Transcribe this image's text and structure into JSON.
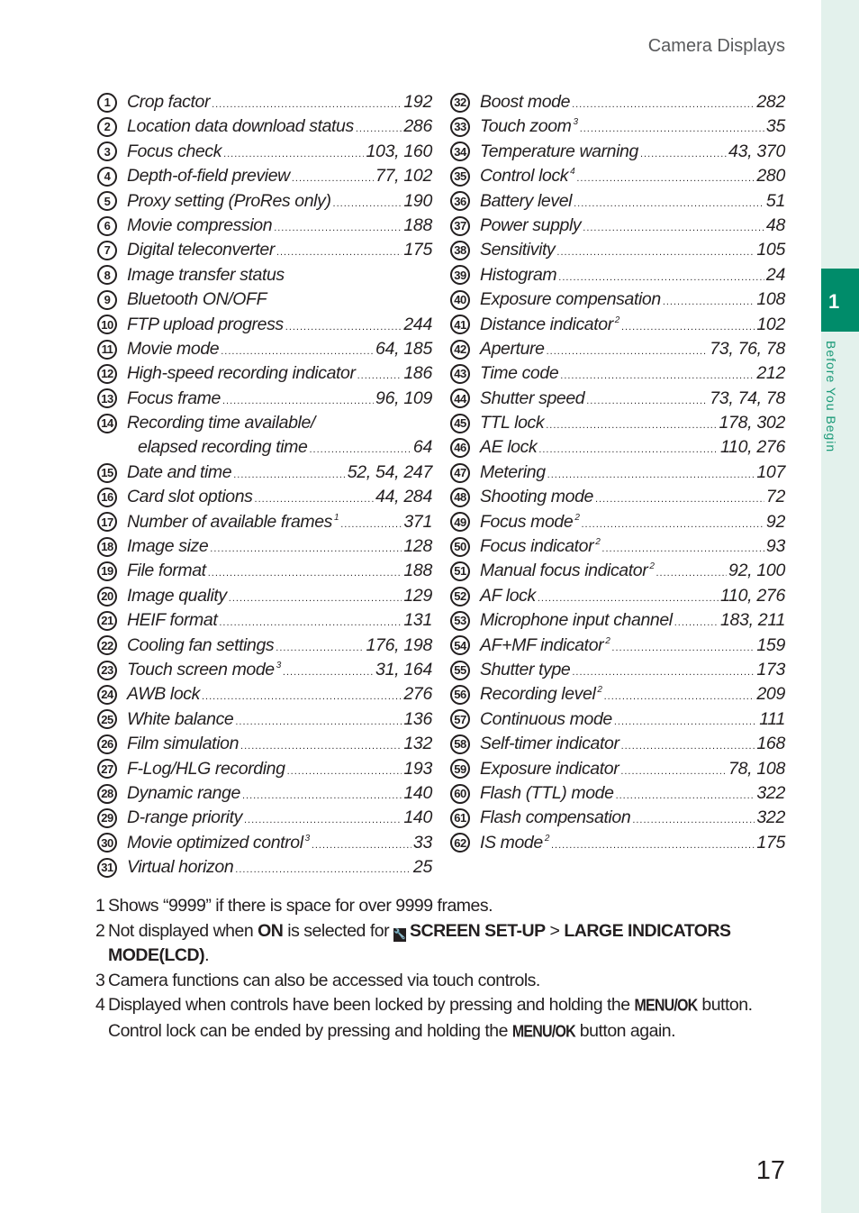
{
  "header": {
    "running_head": "Camera Displays"
  },
  "side_tab": {
    "chapter_number": "1",
    "chapter_title": "Before You Begin",
    "accent_color": "#008c6a",
    "strip_color": "#e3f1ec"
  },
  "page_number": "17",
  "left_column": [
    {
      "num": "1",
      "text": "Crop factor",
      "sup": "",
      "pages": "192"
    },
    {
      "num": "2",
      "text": "Location data download status",
      "sup": "",
      "pages": "286"
    },
    {
      "num": "3",
      "text": "Focus check",
      "sup": "",
      "pages": "103, 160"
    },
    {
      "num": "4",
      "text": "Depth-of-field preview",
      "sup": "",
      "pages": "77, 102"
    },
    {
      "num": "5",
      "text": "Proxy setting (ProRes only)",
      "sup": "",
      "pages": "190"
    },
    {
      "num": "6",
      "text": "Movie compression",
      "sup": "",
      "pages": "188"
    },
    {
      "num": "7",
      "text": "Digital teleconverter",
      "sup": "",
      "pages": "175"
    },
    {
      "num": "8",
      "text": "Image transfer status",
      "sup": "",
      "pages": ""
    },
    {
      "num": "9",
      "text": "Bluetooth ON/OFF",
      "sup": "",
      "pages": ""
    },
    {
      "num": "10",
      "text": "FTP upload progress",
      "sup": "",
      "pages": "244"
    },
    {
      "num": "11",
      "text": "Movie mode",
      "sup": "",
      "pages": "64, 185"
    },
    {
      "num": "12",
      "text": "High-speed recording indicator",
      "sup": "",
      "pages": "186"
    },
    {
      "num": "13",
      "text": "Focus frame",
      "sup": "",
      "pages": "96, 109"
    },
    {
      "num": "14",
      "text": "Recording time available/",
      "sup": "",
      "pages": ""
    },
    {
      "num": "",
      "text": "elapsed recording time",
      "sup": "",
      "pages": "64",
      "continuation": true
    },
    {
      "num": "15",
      "text": "Date and time",
      "sup": "",
      "pages": "52, 54, 247"
    },
    {
      "num": "16",
      "text": "Card slot options",
      "sup": "",
      "pages": "44, 284"
    },
    {
      "num": "17",
      "text": "Number of available frames",
      "sup": "1",
      "pages": "371"
    },
    {
      "num": "18",
      "text": "Image size",
      "sup": "",
      "pages": "128"
    },
    {
      "num": "19",
      "text": "File format",
      "sup": "",
      "pages": "188"
    },
    {
      "num": "20",
      "text": "Image quality",
      "sup": "",
      "pages": "129"
    },
    {
      "num": "21",
      "text": "HEIF format",
      "sup": "",
      "pages": "131"
    },
    {
      "num": "22",
      "text": "Cooling fan settings",
      "sup": "",
      "pages": "176, 198"
    },
    {
      "num": "23",
      "text": "Touch screen mode",
      "sup": "3",
      "pages": "31, 164"
    },
    {
      "num": "24",
      "text": "AWB lock",
      "sup": "",
      "pages": "276"
    },
    {
      "num": "25",
      "text": "White balance",
      "sup": "",
      "pages": "136"
    },
    {
      "num": "26",
      "text": "Film simulation",
      "sup": "",
      "pages": "132"
    },
    {
      "num": "27",
      "text": "F-Log/HLG recording",
      "sup": "",
      "pages": "193"
    },
    {
      "num": "28",
      "text": "Dynamic range",
      "sup": "",
      "pages": "140"
    },
    {
      "num": "29",
      "text": "D-range priority",
      "sup": "",
      "pages": "140"
    },
    {
      "num": "30",
      "text": "Movie optimized control",
      "sup": "3",
      "pages": "33"
    },
    {
      "num": "31",
      "text": "Virtual horizon",
      "sup": "",
      "pages": "25"
    }
  ],
  "right_column": [
    {
      "num": "32",
      "text": "Boost mode",
      "sup": "",
      "pages": "282"
    },
    {
      "num": "33",
      "text": "Touch zoom",
      "sup": "3",
      "pages": "35"
    },
    {
      "num": "34",
      "text": "Temperature warning",
      "sup": "",
      "pages": "43, 370"
    },
    {
      "num": "35",
      "text": "Control lock",
      "sup": "4",
      "pages": "280"
    },
    {
      "num": "36",
      "text": "Battery level",
      "sup": "",
      "pages": "51"
    },
    {
      "num": "37",
      "text": "Power supply",
      "sup": "",
      "pages": "48"
    },
    {
      "num": "38",
      "text": "Sensitivity",
      "sup": "",
      "pages": "105"
    },
    {
      "num": "39",
      "text": "Histogram",
      "sup": "",
      "pages": "24"
    },
    {
      "num": "40",
      "text": "Exposure compensation",
      "sup": "",
      "pages": "108"
    },
    {
      "num": "41",
      "text": "Distance indicator",
      "sup": "2",
      "pages": "102"
    },
    {
      "num": "42",
      "text": "Aperture",
      "sup": "",
      "pages": "73, 76, 78"
    },
    {
      "num": "43",
      "text": "Time code",
      "sup": "",
      "pages": "212"
    },
    {
      "num": "44",
      "text": "Shutter speed",
      "sup": "",
      "pages": "73, 74, 78"
    },
    {
      "num": "45",
      "text": "TTL lock",
      "sup": "",
      "pages": "178, 302"
    },
    {
      "num": "46",
      "text": "AE lock",
      "sup": "",
      "pages": "110, 276"
    },
    {
      "num": "47",
      "text": "Metering",
      "sup": "",
      "pages": "107"
    },
    {
      "num": "48",
      "text": "Shooting mode",
      "sup": "",
      "pages": "72"
    },
    {
      "num": "49",
      "text": "Focus mode",
      "sup": "2",
      "pages": "92"
    },
    {
      "num": "50",
      "text": "Focus indicator",
      "sup": "2",
      "pages": "93"
    },
    {
      "num": "51",
      "text": "Manual focus indicator",
      "sup": "2",
      "pages": "92, 100"
    },
    {
      "num": "52",
      "text": "AF lock",
      "sup": "",
      "pages": "110, 276"
    },
    {
      "num": "53",
      "text": "Microphone input channel",
      "sup": "",
      "pages": "183, 211"
    },
    {
      "num": "54",
      "text": "AF+MF indicator",
      "sup": "2",
      "pages": "159"
    },
    {
      "num": "55",
      "text": "Shutter type",
      "sup": "",
      "pages": "173"
    },
    {
      "num": "56",
      "text": "Recording level",
      "sup": "2",
      "pages": "209"
    },
    {
      "num": "57",
      "text": "Continuous mode",
      "sup": "",
      "pages": "111"
    },
    {
      "num": "58",
      "text": "Self-timer indicator",
      "sup": "",
      "pages": "168"
    },
    {
      "num": "59",
      "text": "Exposure indicator",
      "sup": "",
      "pages": "78, 108"
    },
    {
      "num": "60",
      "text": "Flash (TTL) mode",
      "sup": "",
      "pages": "322"
    },
    {
      "num": "61",
      "text": "Flash compensation",
      "sup": "",
      "pages": "322"
    },
    {
      "num": "62",
      "text": "IS mode",
      "sup": "2",
      "pages": "175"
    }
  ],
  "notes": {
    "n1": {
      "num": "1",
      "text": "Shows “9999” if there is space for over 9999 frames."
    },
    "n2": {
      "num": "2",
      "pre": "Not displayed when ",
      "on": "ON",
      "mid": " is selected for ",
      "icon": "setup-wrench-icon",
      "menu1": "SCREEN SET-UP",
      "sep": " > ",
      "menu2": "LARGE INDICATORS MODE(LCD)",
      "end": "."
    },
    "n3": {
      "num": "3",
      "text": "Camera functions can also be accessed via touch controls."
    },
    "n4": {
      "num": "4",
      "pre": "Displayed when controls have been locked by pressing and holding the ",
      "button1": "MENU/OK",
      "mid": " button. Control lock can be ended by pressing and holding the ",
      "button2": "MENU/OK",
      "end": " button again."
    }
  }
}
